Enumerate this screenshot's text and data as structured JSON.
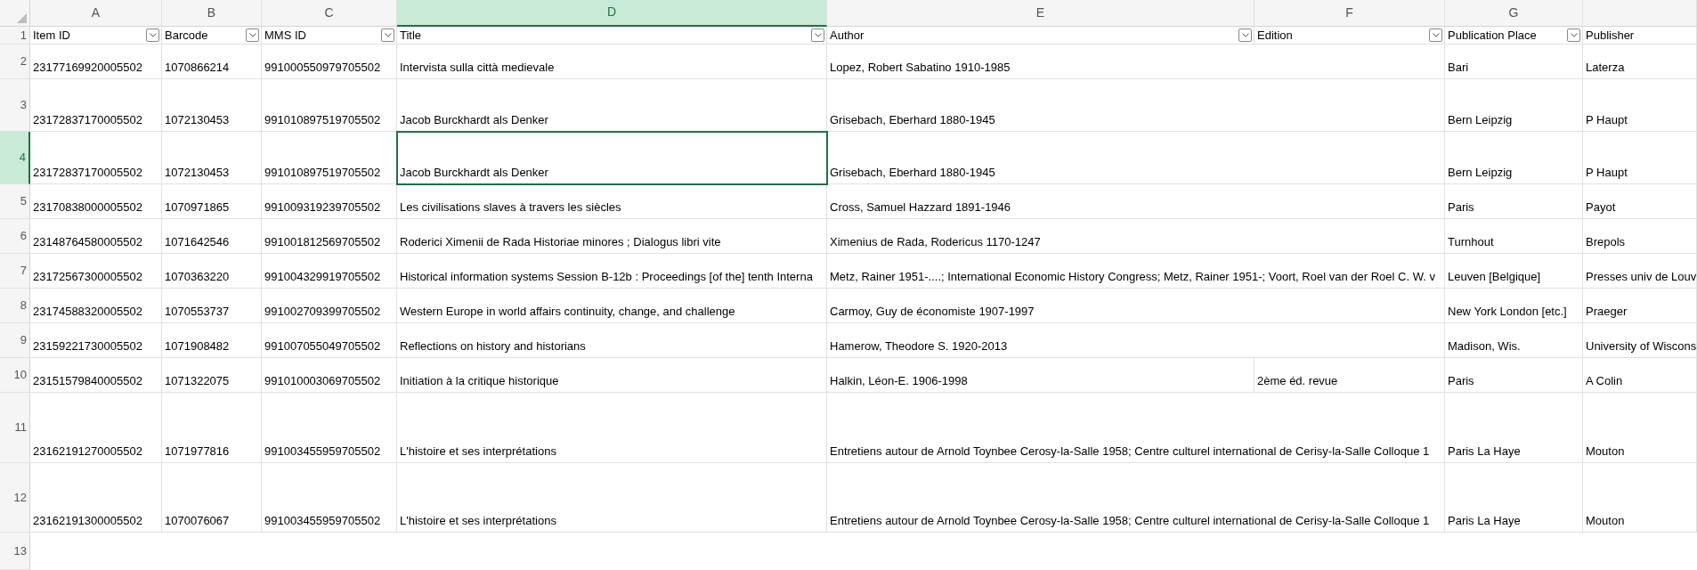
{
  "columns": [
    {
      "letter": "A",
      "header": "Item ID",
      "filter": true,
      "selected": false
    },
    {
      "letter": "B",
      "header": "Barcode",
      "filter": true,
      "selected": false
    },
    {
      "letter": "C",
      "header": "MMS ID",
      "filter": true,
      "selected": false
    },
    {
      "letter": "D",
      "header": "Title",
      "filter": true,
      "selected": true
    },
    {
      "letter": "E",
      "header": "Author",
      "filter": true,
      "selected": false
    },
    {
      "letter": "F",
      "header": "Edition",
      "filter": true,
      "selected": false
    },
    {
      "letter": "G",
      "header": "Publication Place",
      "filter": true,
      "selected": false
    },
    {
      "header": "Publisher",
      "filter": false,
      "selected": false
    }
  ],
  "header_row": {
    "number": "1",
    "selected": false
  },
  "rows": [
    {
      "number": "2",
      "selected": false,
      "cells": [
        "23177169920005502",
        "1070866214",
        "991000550979705502",
        "Intervista sulla città medievale",
        "Lopez, Robert Sabatino 1910-1985",
        null,
        "Bari",
        "Laterza"
      ]
    },
    {
      "number": "3",
      "selected": false,
      "cells": [
        "23172837170005502",
        "1072130453",
        "991010897519705502",
        "Jacob Burckhardt als Denker",
        "Grisebach, Eberhard 1880-1945",
        null,
        "Bern Leipzig",
        "P Haupt"
      ]
    },
    {
      "number": "4",
      "selected": true,
      "cells": [
        "23172837170005502",
        "1072130453",
        "991010897519705502",
        "Jacob Burckhardt als Denker",
        "Grisebach, Eberhard 1880-1945",
        null,
        "Bern Leipzig",
        "P Haupt"
      ]
    },
    {
      "number": "5",
      "selected": false,
      "cells": [
        "23170838000005502",
        "1070971865",
        "991009319239705502",
        "Les civilisations slaves à travers les siècles",
        "Cross, Samuel Hazzard 1891-1946",
        null,
        "Paris",
        "Payot"
      ]
    },
    {
      "number": "6",
      "selected": false,
      "cells": [
        "23148764580005502",
        "1071642546",
        "991001812569705502",
        "Roderici Ximenii de Rada Historiae minores ; Dialogus libri vite",
        "Ximenius de Rada, Rodericus 1170-1247",
        null,
        "Turnhout",
        "Brepols"
      ]
    },
    {
      "number": "7",
      "selected": false,
      "cells": [
        "23172567300005502",
        "1070363220",
        "991004329919705502",
        "Historical information systems Session B-12b : Proceedings [of the] tenth Interna",
        "Metz, Rainer 1951-....; International Economic History Congress; Metz, Rainer 1951-; Voort, Roel van der Roel C. W. v",
        null,
        "Leuven [Belgique]",
        "Presses univ de Louv"
      ]
    },
    {
      "number": "8",
      "selected": false,
      "cells": [
        "23174588320005502",
        "1070553737",
        "991002709399705502",
        "Western Europe in world affairs continuity, change, and challenge",
        "Carmoy, Guy de économiste 1907-1997",
        null,
        "New York London [etc.]",
        "Praeger"
      ]
    },
    {
      "number": "9",
      "selected": false,
      "cells": [
        "23159221730005502",
        "1071908482",
        "991007055049705502",
        "Reflections on history and historians",
        "Hamerow, Theodore S. 1920-2013",
        null,
        "Madison, Wis.",
        "University of Wiscons"
      ]
    },
    {
      "number": "10",
      "selected": false,
      "cells": [
        "23151579840005502",
        "1071322075",
        "991010003069705502",
        "Initiation à la critique historique",
        "Halkin, Léon-E. 1906-1998",
        "2ème éd. revue",
        "Paris",
        "A Colin"
      ]
    },
    {
      "number": "11",
      "selected": false,
      "cells": [
        "23162191270005502",
        "1071977816",
        "991003455959705502",
        "L'histoire et ses interprétations",
        "Entretiens autour de Arnold Toynbee Cerosy-la-Salle 1958; Centre culturel international de Cerisy-la-Salle Colloque 1",
        null,
        "Paris La Haye",
        "Mouton"
      ]
    },
    {
      "number": "12",
      "selected": false,
      "cells": [
        "23162191300005502",
        "1070076067",
        "991003455959705502",
        "L'histoire et ses interprétations",
        "Entretiens autour de Arnold Toynbee Cerosy-la-Salle 1958; Centre culturel international de Cerisy-la-Salle Colloque 1",
        null,
        "Paris La Haye",
        "Mouton"
      ]
    },
    {
      "number": "13",
      "selected": false
    }
  ]
}
